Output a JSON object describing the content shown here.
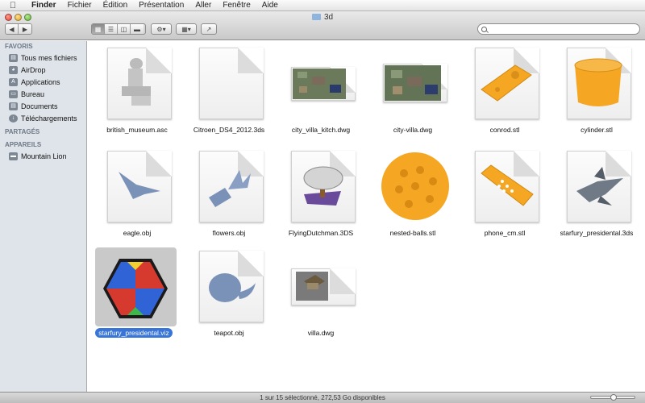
{
  "menubar": {
    "items": [
      {
        "label": "Finder"
      },
      {
        "label": "Fichier"
      },
      {
        "label": "Édition"
      },
      {
        "label": "Présentation"
      },
      {
        "label": "Aller"
      },
      {
        "label": "Fenêtre"
      },
      {
        "label": "Aide"
      }
    ]
  },
  "window": {
    "title": "3d",
    "search": {
      "placeholder": "",
      "value": ""
    }
  },
  "sidebar": {
    "sections": [
      {
        "title": "FAVORIS",
        "items": [
          {
            "label": "Tous mes fichiers",
            "icon": "all-files-icon"
          },
          {
            "label": "AirDrop",
            "icon": "airdrop-icon"
          },
          {
            "label": "Applications",
            "icon": "applications-icon"
          },
          {
            "label": "Bureau",
            "icon": "desktop-icon"
          },
          {
            "label": "Documents",
            "icon": "documents-icon"
          },
          {
            "label": "Téléchargements",
            "icon": "downloads-icon"
          }
        ]
      },
      {
        "title": "PARTAGÉS",
        "items": []
      },
      {
        "title": "APPAREILS",
        "items": [
          {
            "label": "Mountain Lion",
            "icon": "hard-disk-icon"
          }
        ]
      }
    ]
  },
  "files": [
    {
      "name": "british_museum.asc",
      "preview": "gray-statue",
      "selected": false
    },
    {
      "name": "Citroen_DS4_2012.3ds",
      "preview": "blank",
      "selected": false
    },
    {
      "name": "city_villa_kitch.dwg",
      "preview": "city-model",
      "selected": false
    },
    {
      "name": "city-villa.dwg",
      "preview": "city-model",
      "selected": false
    },
    {
      "name": "conrod.stl",
      "preview": "orange-block",
      "selected": false
    },
    {
      "name": "cylinder.stl",
      "preview": "orange-cylinder",
      "selected": false
    },
    {
      "name": "eagle.obj",
      "preview": "blue-eagle",
      "selected": false
    },
    {
      "name": "flowers.obj",
      "preview": "blue-flowers",
      "selected": false
    },
    {
      "name": "FlyingDutchman.3DS",
      "preview": "ship",
      "selected": false
    },
    {
      "name": "nested-balls.stl",
      "preview": "orange-ball",
      "selected": false
    },
    {
      "name": "phone_cm.stl",
      "preview": "orange-phone",
      "selected": false
    },
    {
      "name": "starfury_presidental.3ds",
      "preview": "spaceship",
      "selected": false
    },
    {
      "name": "starfury_presidental.viz",
      "preview": "viz-app-icon",
      "selected": true
    },
    {
      "name": "teapot.obj",
      "preview": "blue-teapot",
      "selected": false
    },
    {
      "name": "villa.dwg",
      "preview": "villa-model",
      "selected": false
    }
  ],
  "status": {
    "text": "1 sur 15 sélectionné, 272,53 Go disponibles"
  },
  "colors": {
    "selection": "#3875d7",
    "orange": "#f5a623",
    "blue_model": "#7a91b8"
  }
}
